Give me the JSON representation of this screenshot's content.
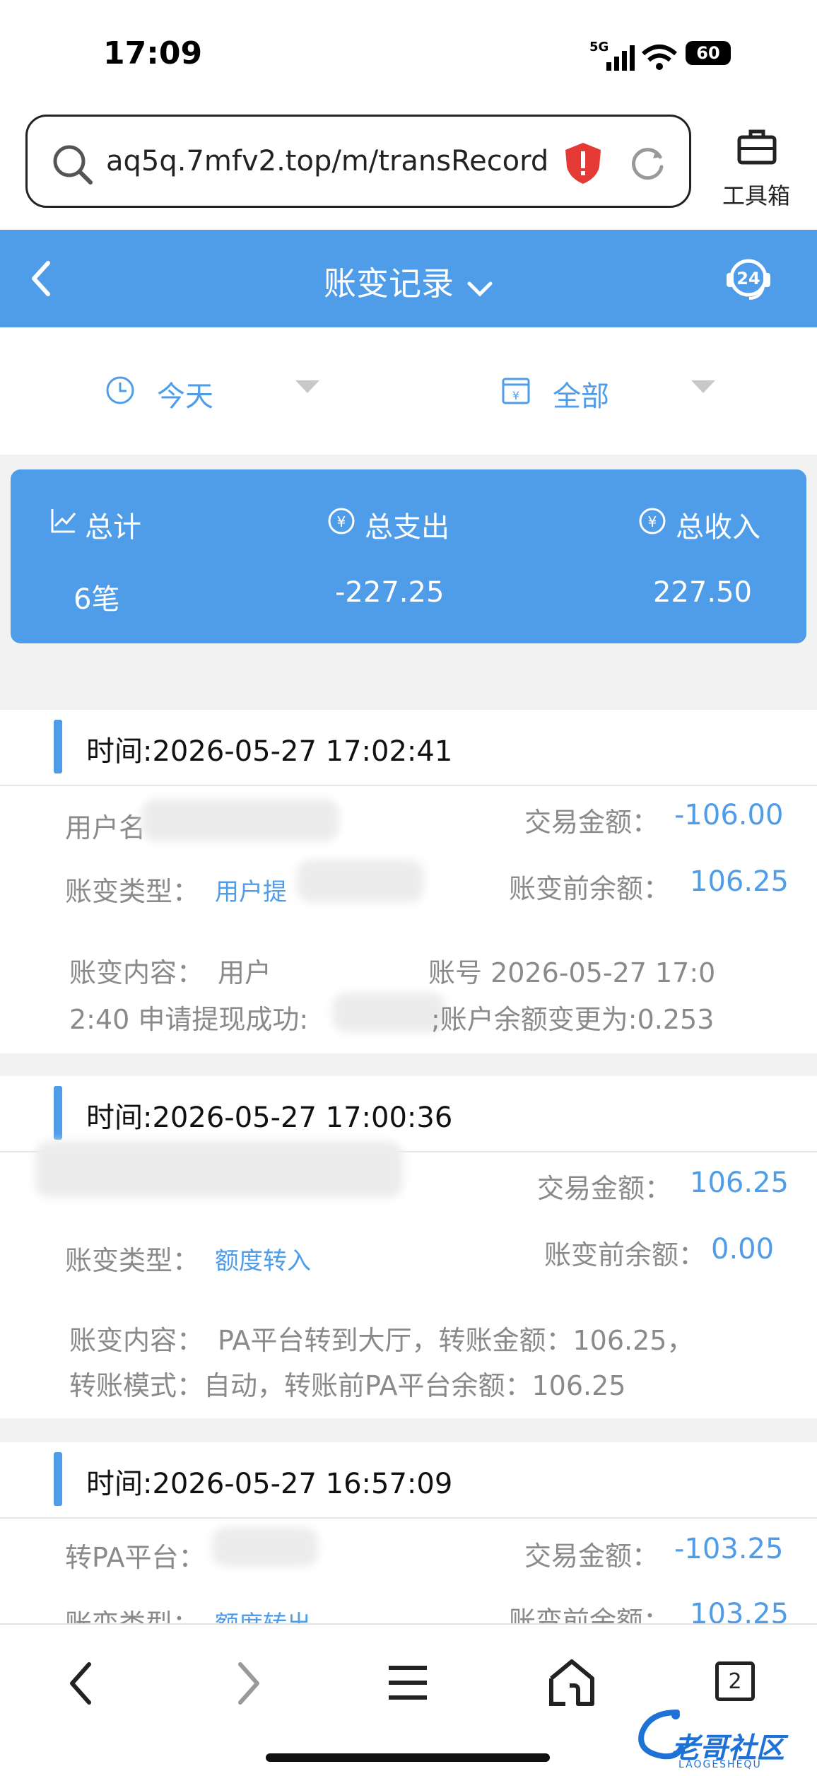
{
  "status_bar": {
    "time": "17:09",
    "network": "5G",
    "battery": "60"
  },
  "browser": {
    "url": "aq5q.7mfv2.top/m/transRecord",
    "toolbox_label": "工具箱",
    "tab_count": "2"
  },
  "header": {
    "title": "账变记录"
  },
  "filters": {
    "date": "今天",
    "type": "全部"
  },
  "summary": {
    "total_label": "总计",
    "total_value": "6笔",
    "expense_label": "总支出",
    "expense_value": "-227.25",
    "income_label": "总收入",
    "income_value": "227.50"
  },
  "labels": {
    "amount": "交易金额：",
    "type": "账变类型：",
    "balance_before": "账变前余额：",
    "content": "账变内容："
  },
  "records": [
    {
      "time": "时间:2026-05-27 17:02:41",
      "user_prefix": "用户名",
      "amount": "-106.00",
      "type": "用户提",
      "balance_before": "106.25",
      "content_a": "用户",
      "content_b": "账号 2026-05-27 17:0",
      "content_line2_a": "2:40 申请提现成功:",
      "content_line2_b": ";账户余额变更为:0.253"
    },
    {
      "time": "时间:2026-05-27 17:00:36",
      "amount": "106.25",
      "type": "额度转入",
      "balance_before": "0.00",
      "content_line1": "PA平台转到大厅，转账金额：106.25，",
      "content_line2": "转账模式：自动，转账前PA平台余额：106.25"
    },
    {
      "time": "时间:2026-05-27 16:57:09",
      "user_prefix": "转PA平台：",
      "amount": "-103.25",
      "type": "额度转出",
      "balance_before": "103.25"
    }
  ],
  "watermark": {
    "text": "老哥社区",
    "sub": "LAOGESHEQU"
  },
  "colors": {
    "primary": "#4f9de9",
    "warning": "#e53935"
  }
}
